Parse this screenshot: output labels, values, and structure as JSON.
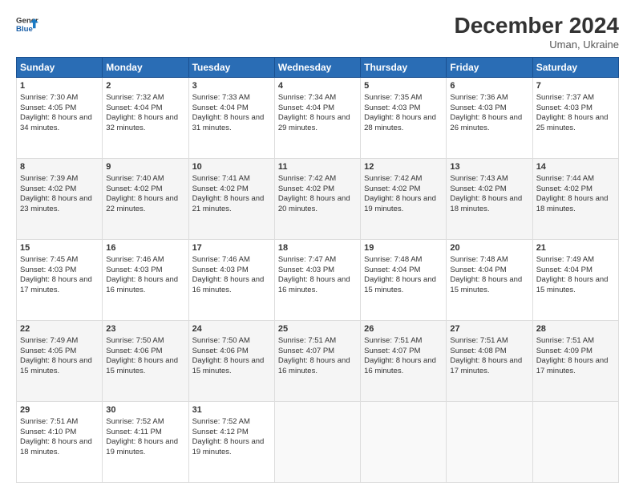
{
  "header": {
    "logo_line1": "General",
    "logo_line2": "Blue",
    "title": "December 2024",
    "subtitle": "Uman, Ukraine"
  },
  "days": [
    "Sunday",
    "Monday",
    "Tuesday",
    "Wednesday",
    "Thursday",
    "Friday",
    "Saturday"
  ],
  "weeks": [
    [
      {
        "day": "1",
        "sunrise": "7:30 AM",
        "sunset": "4:05 PM",
        "daylight": "8 hours and 34 minutes."
      },
      {
        "day": "2",
        "sunrise": "7:32 AM",
        "sunset": "4:04 PM",
        "daylight": "8 hours and 32 minutes."
      },
      {
        "day": "3",
        "sunrise": "7:33 AM",
        "sunset": "4:04 PM",
        "daylight": "8 hours and 31 minutes."
      },
      {
        "day": "4",
        "sunrise": "7:34 AM",
        "sunset": "4:04 PM",
        "daylight": "8 hours and 29 minutes."
      },
      {
        "day": "5",
        "sunrise": "7:35 AM",
        "sunset": "4:03 PM",
        "daylight": "8 hours and 28 minutes."
      },
      {
        "day": "6",
        "sunrise": "7:36 AM",
        "sunset": "4:03 PM",
        "daylight": "8 hours and 26 minutes."
      },
      {
        "day": "7",
        "sunrise": "7:37 AM",
        "sunset": "4:03 PM",
        "daylight": "8 hours and 25 minutes."
      }
    ],
    [
      {
        "day": "8",
        "sunrise": "7:39 AM",
        "sunset": "4:02 PM",
        "daylight": "8 hours and 23 minutes."
      },
      {
        "day": "9",
        "sunrise": "7:40 AM",
        "sunset": "4:02 PM",
        "daylight": "8 hours and 22 minutes."
      },
      {
        "day": "10",
        "sunrise": "7:41 AM",
        "sunset": "4:02 PM",
        "daylight": "8 hours and 21 minutes."
      },
      {
        "day": "11",
        "sunrise": "7:42 AM",
        "sunset": "4:02 PM",
        "daylight": "8 hours and 20 minutes."
      },
      {
        "day": "12",
        "sunrise": "7:42 AM",
        "sunset": "4:02 PM",
        "daylight": "8 hours and 19 minutes."
      },
      {
        "day": "13",
        "sunrise": "7:43 AM",
        "sunset": "4:02 PM",
        "daylight": "8 hours and 18 minutes."
      },
      {
        "day": "14",
        "sunrise": "7:44 AM",
        "sunset": "4:02 PM",
        "daylight": "8 hours and 18 minutes."
      }
    ],
    [
      {
        "day": "15",
        "sunrise": "7:45 AM",
        "sunset": "4:03 PM",
        "daylight": "8 hours and 17 minutes."
      },
      {
        "day": "16",
        "sunrise": "7:46 AM",
        "sunset": "4:03 PM",
        "daylight": "8 hours and 16 minutes."
      },
      {
        "day": "17",
        "sunrise": "7:46 AM",
        "sunset": "4:03 PM",
        "daylight": "8 hours and 16 minutes."
      },
      {
        "day": "18",
        "sunrise": "7:47 AM",
        "sunset": "4:03 PM",
        "daylight": "8 hours and 16 minutes."
      },
      {
        "day": "19",
        "sunrise": "7:48 AM",
        "sunset": "4:04 PM",
        "daylight": "8 hours and 15 minutes."
      },
      {
        "day": "20",
        "sunrise": "7:48 AM",
        "sunset": "4:04 PM",
        "daylight": "8 hours and 15 minutes."
      },
      {
        "day": "21",
        "sunrise": "7:49 AM",
        "sunset": "4:04 PM",
        "daylight": "8 hours and 15 minutes."
      }
    ],
    [
      {
        "day": "22",
        "sunrise": "7:49 AM",
        "sunset": "4:05 PM",
        "daylight": "8 hours and 15 minutes."
      },
      {
        "day": "23",
        "sunrise": "7:50 AM",
        "sunset": "4:06 PM",
        "daylight": "8 hours and 15 minutes."
      },
      {
        "day": "24",
        "sunrise": "7:50 AM",
        "sunset": "4:06 PM",
        "daylight": "8 hours and 15 minutes."
      },
      {
        "day": "25",
        "sunrise": "7:51 AM",
        "sunset": "4:07 PM",
        "daylight": "8 hours and 16 minutes."
      },
      {
        "day": "26",
        "sunrise": "7:51 AM",
        "sunset": "4:07 PM",
        "daylight": "8 hours and 16 minutes."
      },
      {
        "day": "27",
        "sunrise": "7:51 AM",
        "sunset": "4:08 PM",
        "daylight": "8 hours and 17 minutes."
      },
      {
        "day": "28",
        "sunrise": "7:51 AM",
        "sunset": "4:09 PM",
        "daylight": "8 hours and 17 minutes."
      }
    ],
    [
      {
        "day": "29",
        "sunrise": "7:51 AM",
        "sunset": "4:10 PM",
        "daylight": "8 hours and 18 minutes."
      },
      {
        "day": "30",
        "sunrise": "7:52 AM",
        "sunset": "4:11 PM",
        "daylight": "8 hours and 19 minutes."
      },
      {
        "day": "31",
        "sunrise": "7:52 AM",
        "sunset": "4:12 PM",
        "daylight": "8 hours and 19 minutes."
      },
      null,
      null,
      null,
      null
    ]
  ]
}
